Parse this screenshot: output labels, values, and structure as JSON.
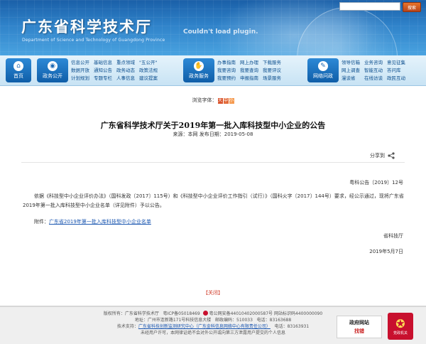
{
  "header": {
    "title": "广东省科学技术厅",
    "subtitle": "Department of Science and Technology of Guangdong Province",
    "plugin_message": "Couldn't load plugin.",
    "search_button": "搜索"
  },
  "nav": {
    "home": "首页",
    "gov_open": {
      "label": "政务公开",
      "links": [
        "信息公开",
        "数据开放",
        "计划规划",
        "基础信息",
        "通知公告",
        "专题专栏",
        "重点领域",
        "政务动态",
        "人事信息",
        "\"五公开\"",
        "政策法规",
        "建议提案"
      ]
    },
    "gov_service": {
      "label": "政务服务",
      "links": [
        "办事指南",
        "我要咨询",
        "我要预约",
        "网上办理",
        "我要查询",
        "申报指南",
        "下载服务",
        "我要评议",
        "场景服务"
      ]
    },
    "interaction": {
      "label": "网络问政",
      "links": [
        "领导信箱",
        "网上调查",
        "漫谈省",
        "业务咨询",
        "智能互动",
        "在线访谈",
        "意见征集",
        "答问库",
        "政民互动"
      ]
    }
  },
  "font_size": {
    "label": "浏览字体：",
    "options": [
      "大",
      "中",
      "小"
    ]
  },
  "article": {
    "title": "广东省科学技术厅关于2019年第一批入库科技型中小企业的公告",
    "meta": "来源：本网   发布日期：2019-05-08",
    "share": "分享到",
    "doc_number": "粤科公告〔2019〕12号",
    "body": "依据《科技型中小企业评价办法》（国科发政〔2017〕115号）和《科技型中小企业评价工作指引（试行）》（国科火字〔2017〕144号）要求，经公示通过，现将广东省2019年第一批入库科技型中小企业名单（详见附件）予以公告。",
    "attachment_label": "附件：",
    "attachment_link": "广东省2019年第一批入库科技型中小企业名单",
    "signer": "省科技厅",
    "date": "2019年5月7日",
    "close": "【关闭】"
  },
  "footer": {
    "copyright": "版权所有：广东省科学技术厅",
    "icp": "粤ICP备05018469",
    "police": "粤公网安备44010402000587号",
    "site_code": "网站标识码4400000090",
    "address": "地址：广州市连新路171号科技信息大楼",
    "postcode": "邮政编码：510033",
    "phone": "电话：83163688",
    "tech_support_label": "技术支持：",
    "tech_support_link": "广东省科技创新监测研究中心（广东金科信息网络中心有限责任公司）",
    "tech_phone": "电话：83163931",
    "notice": "未经用户许可，本网律证绝不会对外公开或向第三方泄露用户提交的个人信息",
    "badge_top": "政府网站",
    "badge_bottom": "找错",
    "party_caption": "党政机关"
  }
}
